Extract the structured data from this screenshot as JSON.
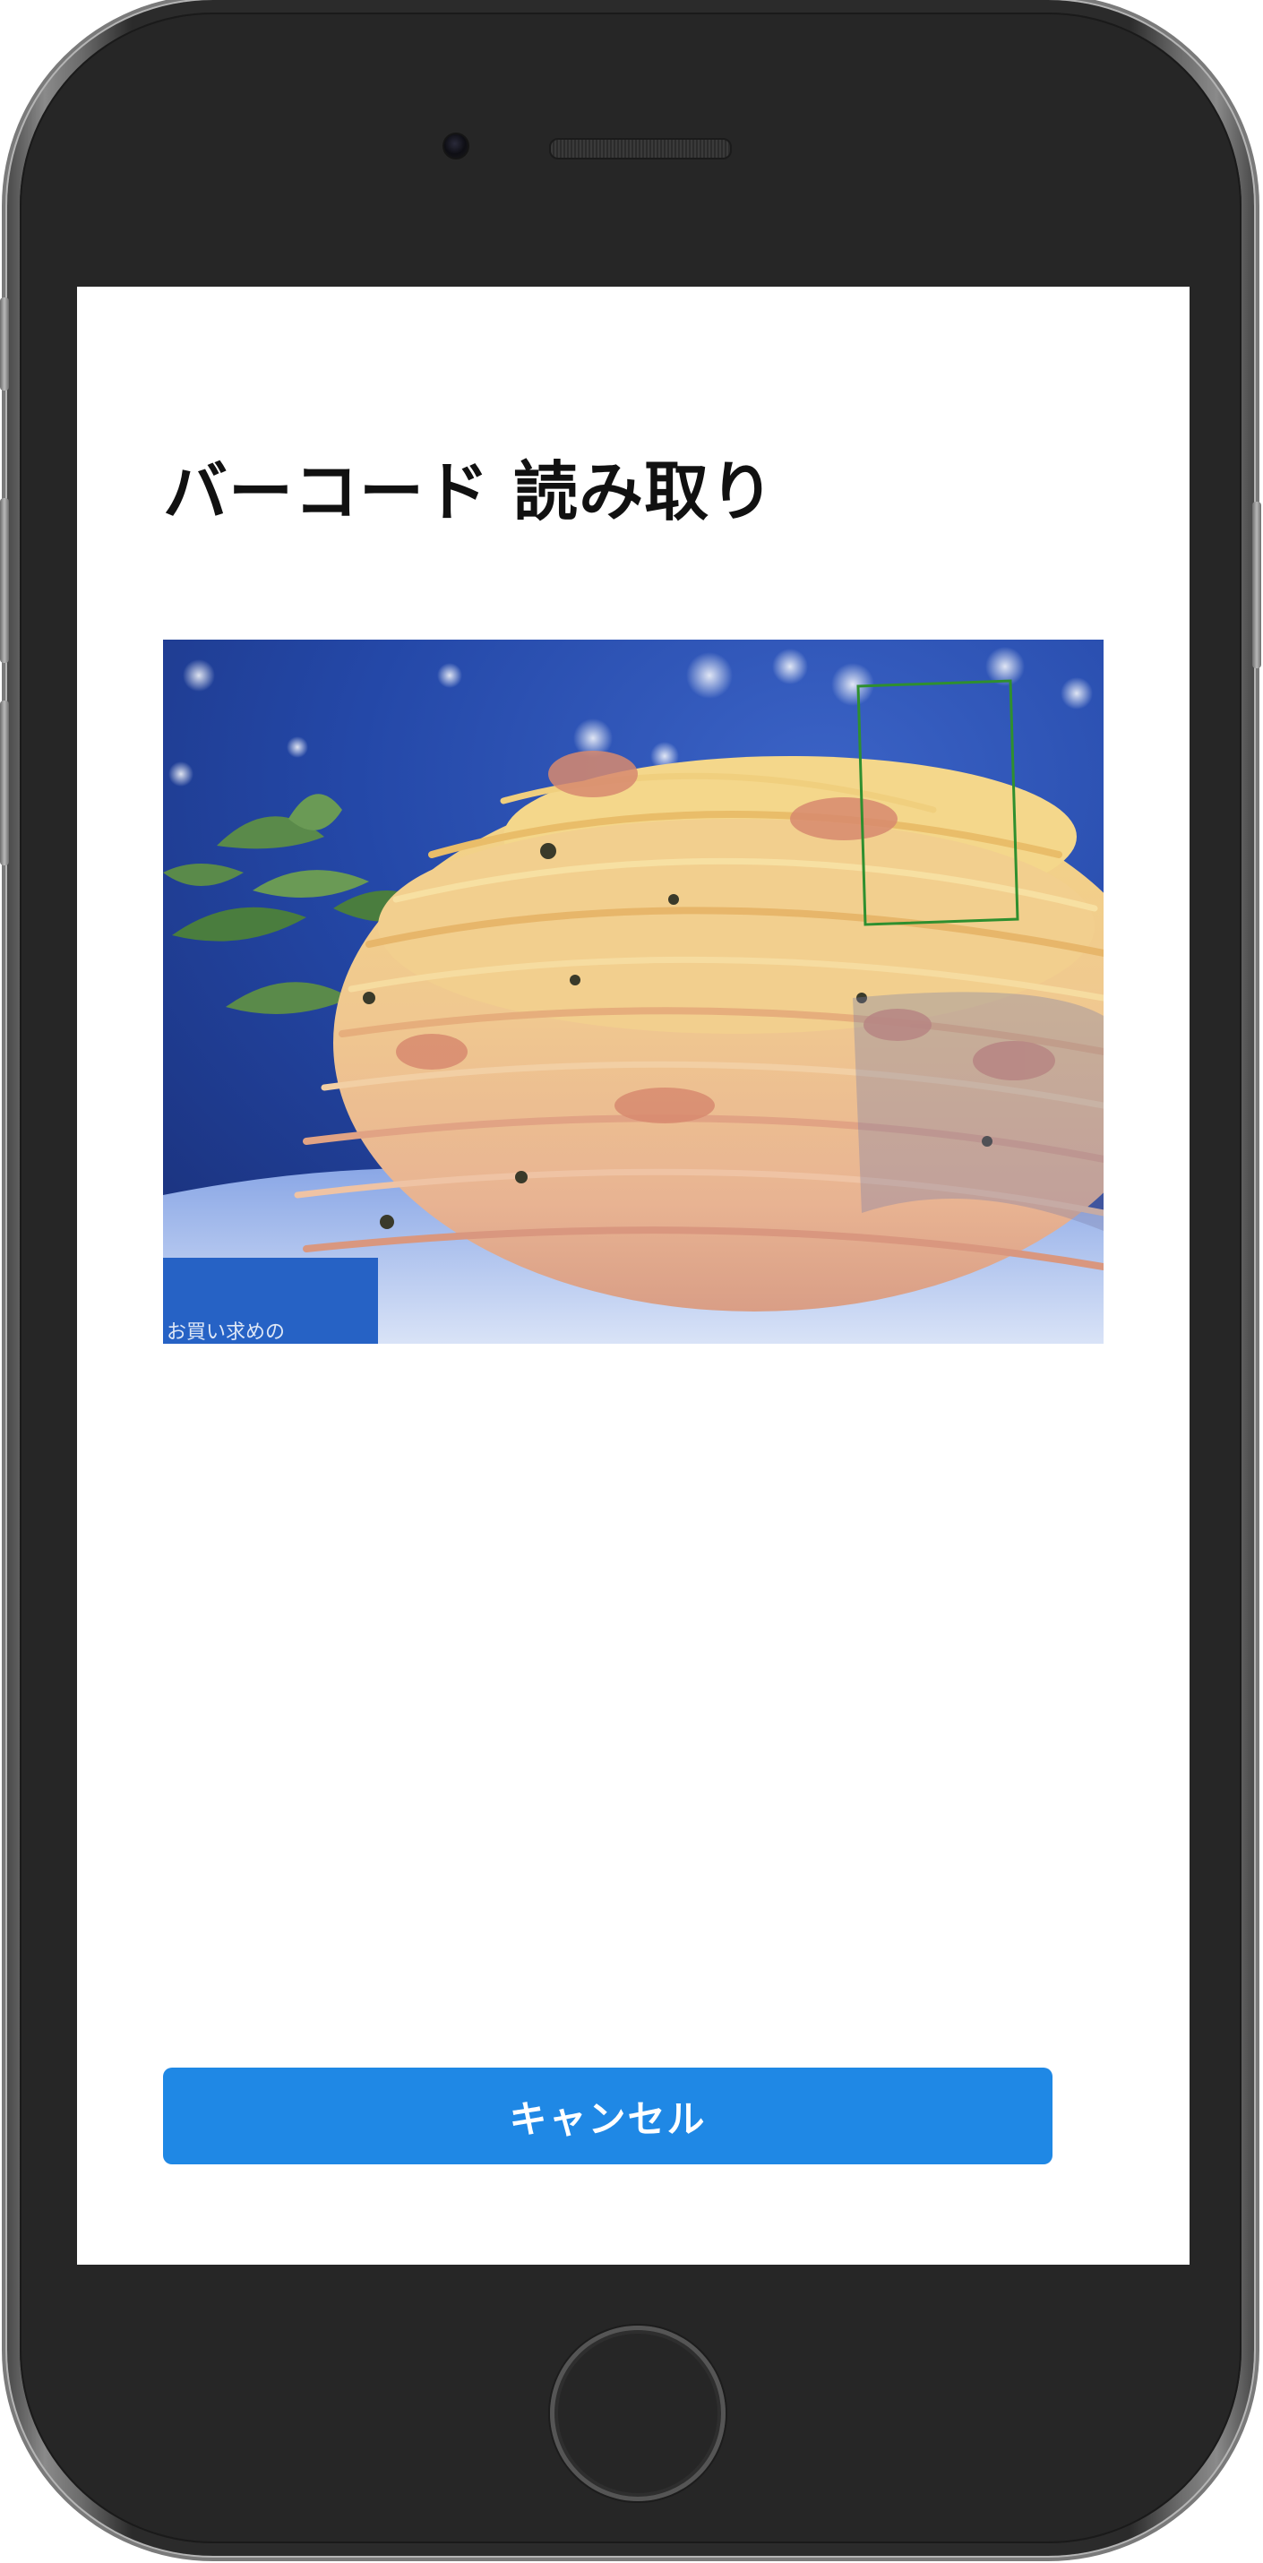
{
  "screen": {
    "title": "バーコード 読み取り",
    "camera_preview": {
      "scan_box_color": "#2f8f2f",
      "partial_overlay_text": "お買い求めの"
    },
    "cancel_button_label": "キャンセル"
  },
  "colors": {
    "primary_button": "#1f88e5",
    "phone_body": "#262626",
    "screen_background": "#ffffff"
  }
}
